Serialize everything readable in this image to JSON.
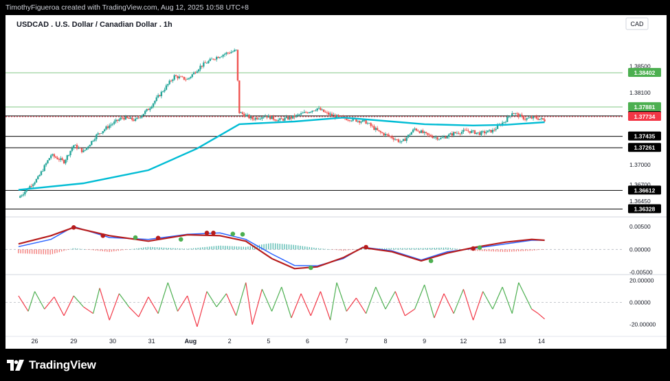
{
  "attribution": "TimothyFigueroa created with TradingView.com, Aug 12, 2025 10:58 UTC+8",
  "brand": "TradingView",
  "chart_data": [
    {
      "type": "line",
      "title": "USDCAD . U.S. Dollar / Canadian Dollar . 1h",
      "currency": "CAD",
      "x_tick_labels": [
        "26",
        "29",
        "30",
        "31",
        "Aug",
        "2",
        "5",
        "6",
        "7",
        "8",
        "9",
        "12",
        "13",
        "14"
      ],
      "y_tick_labels": [
        "1.38500",
        "1.38100",
        "1.37000",
        "1.36700",
        "1.36450"
      ],
      "y_tick_values": [
        1.385,
        1.381,
        1.37,
        1.367,
        1.3645
      ],
      "ylim": [
        1.3625,
        1.3905
      ],
      "horizontal_levels": [
        {
          "label": "1.38402",
          "value": 1.38402,
          "color": "#4caf50",
          "line": "#81c784"
        },
        {
          "label": "1.37881",
          "value": 1.37881,
          "color": "#4caf50",
          "line": "#81c784"
        },
        {
          "label": "1.37745",
          "value": 1.37745,
          "color": "#000000",
          "line": "#000000"
        },
        {
          "label": "1.37734",
          "value": 1.37734,
          "color": "#f23645",
          "line": "#f23645",
          "dashed": true
        },
        {
          "label": "1.37435",
          "value": 1.37435,
          "color": "#000000",
          "line": "#000000"
        },
        {
          "label": "1.37261",
          "value": 1.37261,
          "color": "#000000",
          "line": "#000000"
        },
        {
          "label": "1.36612",
          "value": 1.36612,
          "color": "#000000",
          "line": "#000000"
        },
        {
          "label": "1.36328",
          "value": 1.36328,
          "color": "#000000",
          "line": "#000000"
        }
      ],
      "price_path": [
        [
          0,
          1.365
        ],
        [
          6,
          1.368
        ],
        [
          10,
          1.3715
        ],
        [
          14,
          1.3705
        ],
        [
          17,
          1.373
        ],
        [
          20,
          1.372
        ],
        [
          24,
          1.3745
        ],
        [
          28,
          1.376
        ],
        [
          32,
          1.3772
        ],
        [
          36,
          1.3768
        ],
        [
          40,
          1.3785
        ],
        [
          44,
          1.381
        ],
        [
          48,
          1.3835
        ],
        [
          52,
          1.383
        ],
        [
          56,
          1.385
        ],
        [
          60,
          1.3862
        ],
        [
          64,
          1.387
        ],
        [
          67,
          1.3874
        ],
        [
          68,
          1.378
        ],
        [
          72,
          1.377
        ],
        [
          76,
          1.3775
        ],
        [
          80,
          1.3768
        ],
        [
          84,
          1.3772
        ],
        [
          88,
          1.3779
        ],
        [
          92,
          1.3786
        ],
        [
          95,
          1.3778
        ],
        [
          99,
          1.3772
        ],
        [
          103,
          1.3769
        ],
        [
          107,
          1.3765
        ],
        [
          111,
          1.375
        ],
        [
          115,
          1.3742
        ],
        [
          118,
          1.3734
        ],
        [
          122,
          1.3755
        ],
        [
          126,
          1.3745
        ],
        [
          130,
          1.374
        ],
        [
          134,
          1.3748
        ],
        [
          138,
          1.3752
        ],
        [
          142,
          1.3748
        ],
        [
          146,
          1.3752
        ],
        [
          150,
          1.3768
        ],
        [
          152,
          1.378
        ],
        [
          156,
          1.377
        ],
        [
          159,
          1.3772
        ],
        [
          162,
          1.3768
        ]
      ],
      "ma_path": [
        [
          0,
          1.3662
        ],
        [
          20,
          1.3672
        ],
        [
          40,
          1.3692
        ],
        [
          55,
          1.3725
        ],
        [
          68,
          1.3762
        ],
        [
          85,
          1.3766
        ],
        [
          100,
          1.3772
        ],
        [
          115,
          1.3766
        ],
        [
          125,
          1.3762
        ],
        [
          140,
          1.376
        ],
        [
          150,
          1.3761
        ],
        [
          162,
          1.3765
        ]
      ],
      "price_color": "#26a69a",
      "ma_color": "#00bcd4"
    },
    {
      "type": "line",
      "title": "",
      "y_tick_labels": [
        "0.00500",
        "0.00000",
        "-0.00500"
      ],
      "y_tick_values": [
        0.005,
        0.0,
        -0.005
      ],
      "ylim": [
        -0.0055,
        0.0062
      ],
      "series": [
        {
          "name": "",
          "color": "#2962ff",
          "values": [
            [
              0,
              0.0006
            ],
            [
              10,
              0.0022
            ],
            [
              17,
              0.005
            ],
            [
              28,
              0.0026
            ],
            [
              40,
              0.0022
            ],
            [
              52,
              0.0033
            ],
            [
              62,
              0.0036
            ],
            [
              70,
              0.0022
            ],
            [
              78,
              -0.001
            ],
            [
              85,
              -0.0035
            ],
            [
              92,
              -0.0036
            ],
            [
              100,
              -0.002
            ],
            [
              106,
              0.0005
            ],
            [
              115,
              -0.0003
            ],
            [
              124,
              -0.0023
            ],
            [
              132,
              -0.0005
            ],
            [
              140,
              0.0002
            ],
            [
              150,
              0.0012
            ],
            [
              158,
              0.002
            ],
            [
              162,
              0.002
            ]
          ]
        },
        {
          "name": "",
          "color": "#b71c1c",
          "values": [
            [
              0,
              0.0012
            ],
            [
              10,
              0.003
            ],
            [
              17,
              0.0048
            ],
            [
              28,
              0.003
            ],
            [
              40,
              0.0018
            ],
            [
              52,
              0.0032
            ],
            [
              62,
              0.003
            ],
            [
              70,
              0.0018
            ],
            [
              78,
              -0.002
            ],
            [
              85,
              -0.0042
            ],
            [
              92,
              -0.0038
            ],
            [
              100,
              -0.0018
            ],
            [
              106,
              0.0004
            ],
            [
              115,
              -0.0005
            ],
            [
              124,
              -0.0025
            ],
            [
              132,
              -0.0008
            ],
            [
              140,
              0.0004
            ],
            [
              150,
              0.0016
            ],
            [
              158,
              0.0022
            ],
            [
              162,
              0.002
            ]
          ]
        }
      ],
      "cross_markers": [
        {
          "x": 17,
          "y": 0.0048,
          "color": "#b71c1c"
        },
        {
          "x": 26,
          "y": 0.003,
          "color": "#b71c1c"
        },
        {
          "x": 36,
          "y": 0.0026,
          "color": "#4caf50"
        },
        {
          "x": 43,
          "y": 0.0025,
          "color": "#b71c1c"
        },
        {
          "x": 50,
          "y": 0.0022,
          "color": "#4caf50"
        },
        {
          "x": 58,
          "y": 0.0036,
          "color": "#b71c1c"
        },
        {
          "x": 60,
          "y": 0.0036,
          "color": "#b71c1c"
        },
        {
          "x": 66,
          "y": 0.0034,
          "color": "#4caf50"
        },
        {
          "x": 69,
          "y": 0.0033,
          "color": "#4caf50"
        },
        {
          "x": 90,
          "y": -0.004,
          "color": "#4caf50"
        },
        {
          "x": 107,
          "y": 0.0005,
          "color": "#b71c1c"
        },
        {
          "x": 127,
          "y": -0.0025,
          "color": "#4caf50"
        },
        {
          "x": 140,
          "y": 0.0002,
          "color": "#b71c1c"
        },
        {
          "x": 142,
          "y": 0.0004,
          "color": "#4caf50"
        }
      ]
    },
    {
      "type": "line",
      "title": "",
      "y_tick_labels": [
        "20.00000",
        "0.00000",
        "-20.00000"
      ],
      "y_tick_values": [
        20,
        0,
        -20
      ],
      "ylim": [
        -27,
        24
      ],
      "series": [
        {
          "name": "",
          "color": "#4caf50",
          "values": [
            [
              0,
              6
            ],
            [
              3,
              -8
            ],
            [
              5,
              10
            ],
            [
              8,
              -6
            ],
            [
              11,
              5
            ],
            [
              14,
              -12
            ],
            [
              17,
              6
            ],
            [
              20,
              -4
            ],
            [
              23,
              -10
            ],
            [
              25,
              13
            ],
            [
              28,
              -16
            ],
            [
              31,
              8
            ],
            [
              34,
              -4
            ],
            [
              37,
              -13
            ],
            [
              40,
              5
            ],
            [
              43,
              -10
            ],
            [
              46,
              18
            ],
            [
              49,
              -8
            ],
            [
              52,
              6
            ],
            [
              55,
              -22
            ],
            [
              58,
              10
            ],
            [
              61,
              -4
            ],
            [
              64,
              8
            ],
            [
              67,
              -12
            ],
            [
              70,
              18
            ],
            [
              72,
              -20
            ],
            [
              75,
              12
            ],
            [
              78,
              -8
            ],
            [
              81,
              14
            ],
            [
              84,
              -14
            ],
            [
              87,
              8
            ],
            [
              90,
              -12
            ],
            [
              93,
              10
            ],
            [
              96,
              -16
            ],
            [
              98,
              18
            ],
            [
              101,
              -8
            ],
            [
              104,
              4
            ],
            [
              107,
              -10
            ],
            [
              110,
              14
            ],
            [
              113,
              -6
            ],
            [
              116,
              10
            ],
            [
              119,
              -12
            ],
            [
              122,
              -6
            ],
            [
              125,
              16
            ],
            [
              128,
              -14
            ],
            [
              131,
              8
            ],
            [
              134,
              -10
            ],
            [
              137,
              12
            ],
            [
              140,
              -16
            ],
            [
              143,
              10
            ],
            [
              146,
              -6
            ],
            [
              149,
              14
            ],
            [
              152,
              -10
            ],
            [
              154,
              18
            ],
            [
              156,
              6
            ],
            [
              158,
              -6
            ],
            [
              160,
              -10
            ],
            [
              162,
              -15
            ]
          ]
        }
      ],
      "negative_color": "#f23645"
    }
  ]
}
